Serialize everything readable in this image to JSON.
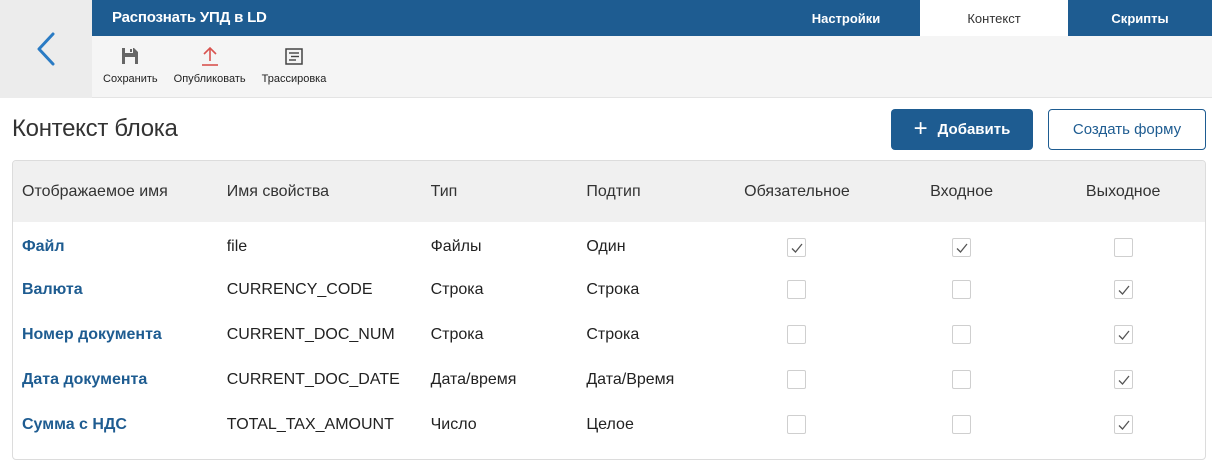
{
  "header": {
    "title": "Распознать УПД в LD",
    "tabs": [
      {
        "label": "Настройки",
        "active": false
      },
      {
        "label": "Контекст",
        "active": true
      },
      {
        "label": "Скрипты",
        "active": false
      }
    ]
  },
  "toolbar": {
    "save_label": "Сохранить",
    "publish_label": "Опубликовать",
    "trace_label": "Трассировка"
  },
  "main": {
    "title": "Контекст блока",
    "add_button": "Добавить",
    "create_form_button": "Создать форму"
  },
  "table": {
    "columns": [
      "Отображаемое имя",
      "Имя свойства",
      "Тип",
      "Подтип",
      "Обязательное",
      "Входное",
      "Выходное"
    ],
    "rows": [
      {
        "name": "Файл",
        "property": "file",
        "type": "Файлы",
        "subtype": "Один",
        "required": true,
        "input": true,
        "output": false
      },
      {
        "name": "Валюта",
        "property": "CURRENCY_CODE",
        "type": "Строка",
        "subtype": "Строка",
        "required": false,
        "input": false,
        "output": true
      },
      {
        "name": "Номер документа",
        "property": "CURRENT_DOC_NUM",
        "type": "Строка",
        "subtype": "Строка",
        "required": false,
        "input": false,
        "output": true
      },
      {
        "name": "Дата документа",
        "property": "CURRENT_DOC_DATE",
        "type": "Дата/время",
        "subtype": "Дата/Время",
        "required": false,
        "input": false,
        "output": true
      },
      {
        "name": "Сумма с НДС",
        "property": "TOTAL_TAX_AMOUNT",
        "type": "Число",
        "subtype": "Целое",
        "required": false,
        "input": false,
        "output": true
      }
    ]
  },
  "icons": {
    "back": "chevron-left-icon",
    "save": "floppy-disk-icon",
    "publish": "upload-arrow-icon",
    "trace": "document-list-icon",
    "add": "plus-icon",
    "check": "checkmark-icon"
  },
  "colors": {
    "accent": "#1e5c91",
    "publish_icon": "#d9534f"
  }
}
